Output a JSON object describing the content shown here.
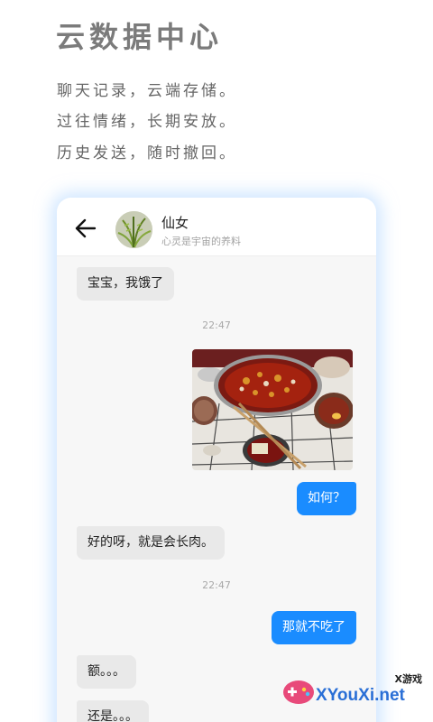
{
  "promo": {
    "headline": "云数据中心",
    "lines": [
      "聊天记录，云端存储。",
      "过往情绪，长期安放。",
      "历史发送，随时撤回。"
    ]
  },
  "chat": {
    "contact_name": "仙女",
    "contact_signature": "心灵是宇宙的养料",
    "back_icon": "arrow-left-icon",
    "messages": [
      {
        "side": "in",
        "text": "宝宝，我饿了"
      },
      {
        "type": "time",
        "text": "22:47"
      },
      {
        "side": "out",
        "type": "image",
        "alt": "hotpot-photo"
      },
      {
        "side": "out",
        "text": "如何？"
      },
      {
        "side": "in",
        "text": "好的呀，就是会长肉。"
      },
      {
        "type": "time",
        "text": "22:47"
      },
      {
        "side": "out",
        "text": "那就不吃了"
      },
      {
        "side": "in",
        "text": "额。。。"
      },
      {
        "side": "in",
        "text": "还是。。。"
      }
    ]
  },
  "watermark": {
    "small": "X游戏",
    "big": "XYouXi.net"
  },
  "colors": {
    "outgoing_bubble": "#1a8cff",
    "incoming_bubble": "#e9e9e9",
    "card_glow": "#aad2ff"
  }
}
